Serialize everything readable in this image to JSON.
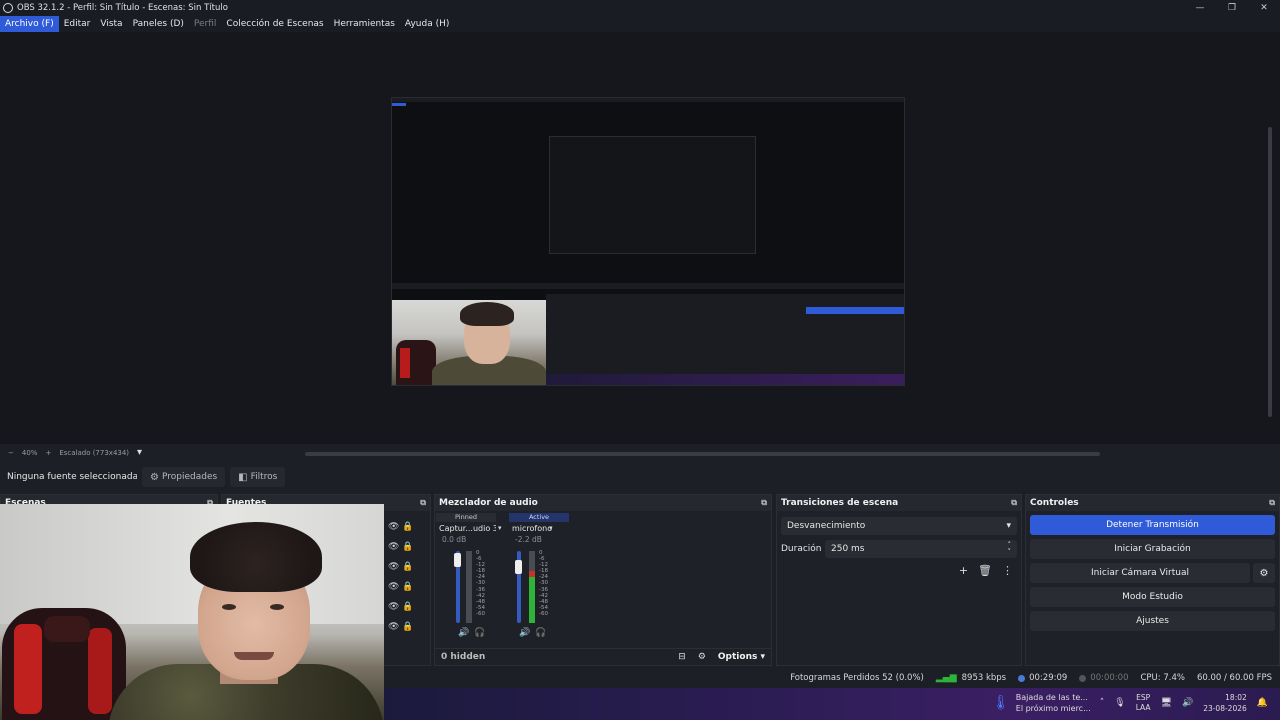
{
  "window": {
    "title": "OBS 32.1.2 - Perfil: Sin Título - Escenas: Sin Título",
    "min": "—",
    "max": "❐",
    "close": "✕"
  },
  "menu": {
    "items": [
      {
        "label": "Archivo (F)"
      },
      {
        "label": "Editar"
      },
      {
        "label": "Vista"
      },
      {
        "label": "Paneles (D)"
      },
      {
        "label": "Perfil"
      },
      {
        "label": "Colección de Escenas"
      },
      {
        "label": "Herramientas"
      },
      {
        "label": "Ayuda (H)"
      }
    ]
  },
  "preview": {
    "zoom_minus": "−",
    "zoom_value": "40%",
    "zoom_plus": "+",
    "scale_label": "Escalado (773x434)",
    "scale_dropdown": "▾"
  },
  "source_toolbar": {
    "no_source": "Ninguna fuente seleccionada",
    "properties": "Propiedades",
    "filters": "Filtros"
  },
  "docks": {
    "scenes": {
      "title": "Escenas"
    },
    "sources": {
      "title": "Fuentes"
    },
    "mixer": {
      "title": "Mezclador de audio",
      "channels": [
        {
          "tag": "Pinned",
          "name": "Captur...udio 3",
          "db": "0.0 dB",
          "meter_level": 0.0
        },
        {
          "tag": "Active",
          "name": "microfono",
          "db": "-2.2 dB",
          "meter_level": 0.72
        }
      ],
      "scale": [
        "0",
        "-6",
        "-12",
        "-18",
        "-24",
        "-30",
        "-36",
        "-42",
        "-48",
        "-54",
        "-60"
      ],
      "hidden": "0 hidden",
      "options": "Options"
    },
    "transitions": {
      "title": "Transiciones de escena",
      "selected": "Desvanecimiento",
      "duration_label": "Duración",
      "duration_value": "250 ms"
    },
    "controls": {
      "title": "Controles",
      "stop_stream": "Detener Transmisión",
      "start_record": "Iniciar Grabación",
      "start_vcam": "Iniciar Cámara Virtual",
      "studio": "Modo Estudio",
      "settings": "Ajustes"
    }
  },
  "status": {
    "dropped": "Fotogramas Perdidos 52 (0.0%)",
    "bitrate": "8953 kbps",
    "stream_time": "00:29:09",
    "record_time": "00:00:00",
    "cpu": "CPU: 7.4%",
    "fps": "60.00 / 60.00 FPS"
  },
  "taskbar": {
    "weather_title": "Bajada de las te...",
    "weather_sub": "El próximo mierc...",
    "lang1": "ESP",
    "lang2": "LAA",
    "time": "18:02",
    "date": "23-08-2026"
  },
  "colors": {
    "accent": "#2f5bd8",
    "meter_green": "#2fb43a"
  }
}
